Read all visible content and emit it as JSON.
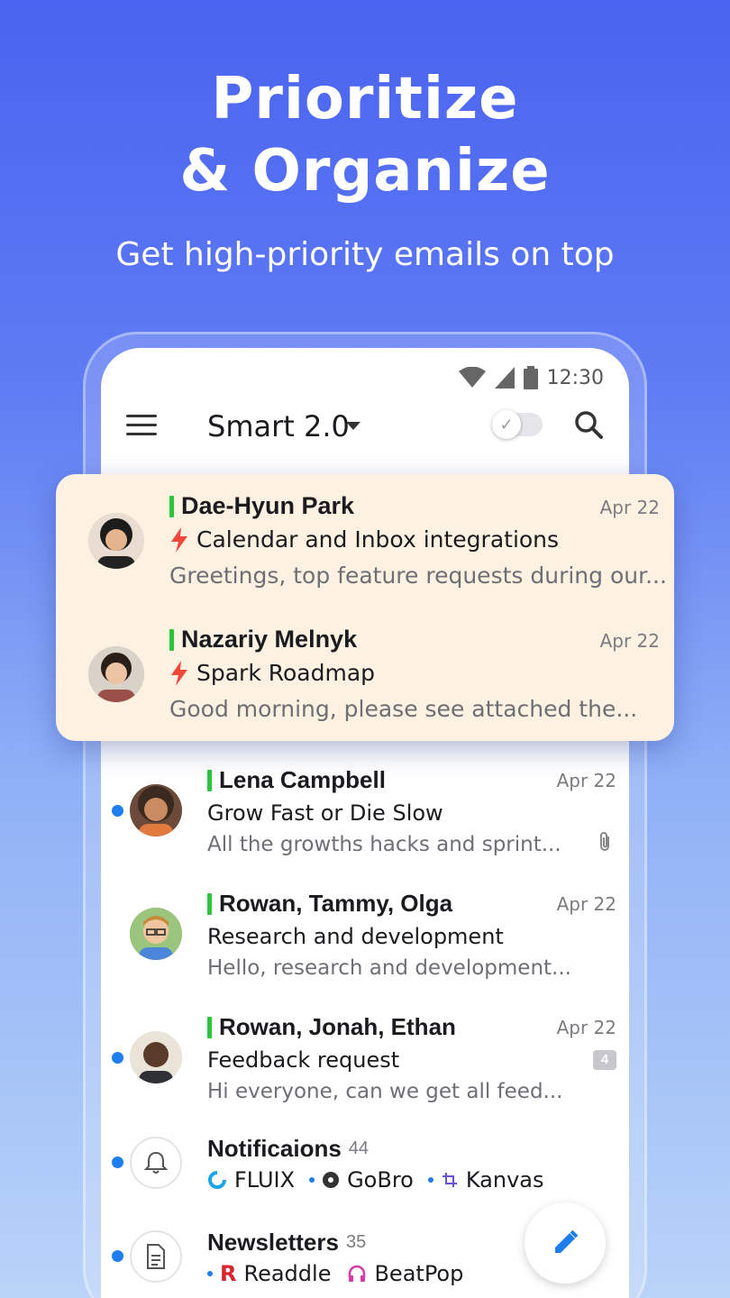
{
  "hero": {
    "title_line1": "Prioritize",
    "title_line2": "& Organize",
    "subtitle": "Get high-priority emails on top"
  },
  "status_bar": {
    "time": "12:30"
  },
  "top_bar": {
    "title": "Smart 2.0"
  },
  "priority_emails": [
    {
      "sender": "Dae-Hyun Park",
      "date": "Apr 22",
      "subject": "Calendar and Inbox integrations",
      "preview": "Greetings, top feature requests during our..."
    },
    {
      "sender": "Nazariy Melnyk",
      "date": "Apr 22",
      "subject": "Spark Roadmap",
      "preview": "Good morning, please see attached the..."
    }
  ],
  "emails": [
    {
      "sender": "Lena Campbell",
      "date": "Apr 22",
      "subject": "Grow Fast or Die Slow",
      "preview": "All the growths hacks and sprint...",
      "unread": true,
      "attachment": true
    },
    {
      "sender": "Rowan, Tammy, Olga",
      "date": "Apr 22",
      "subject": "Research and development",
      "preview": "Hello, research and development...",
      "unread": false
    },
    {
      "sender": "Rowan, Jonah, Ethan",
      "date": "Apr 22",
      "subject": "Feedback request",
      "preview": "Hi everyone, can we get all feed...",
      "unread": true,
      "thread_count": "4"
    }
  ],
  "groups": [
    {
      "name": "Notificaions",
      "count": "44",
      "apps": [
        "FLUIX",
        "GoBro",
        "Kanvas"
      ]
    },
    {
      "name": "Newsletters",
      "count": "35",
      "apps": [
        "Readdle",
        "BeatPop"
      ]
    }
  ],
  "colors": {
    "accent": "#1e7ef0",
    "priority": "#2ec33b",
    "card_bg": "#fdf1e1",
    "bolt": "#f0473b"
  }
}
